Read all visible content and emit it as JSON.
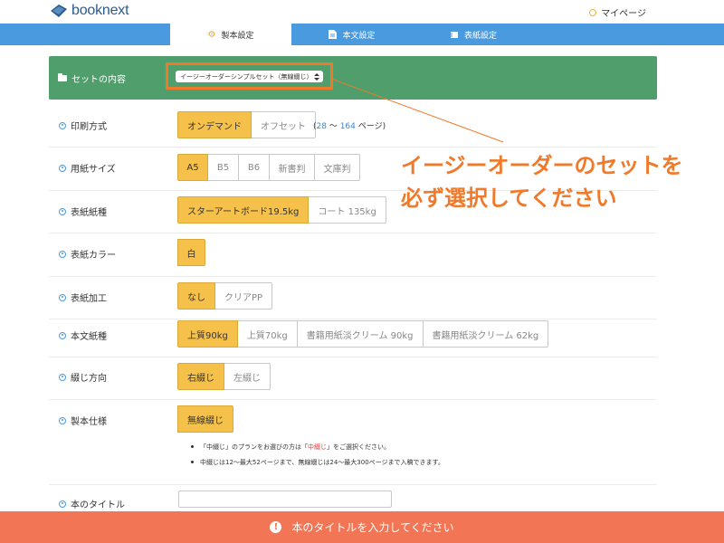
{
  "header": {
    "logo_text": "booknext",
    "mypage_label": "マイページ"
  },
  "tabs": [
    {
      "label": "製本設定",
      "icon": "gear-icon",
      "active": true
    },
    {
      "label": "本文設定",
      "icon": "document-icon",
      "active": false
    },
    {
      "label": "表紙設定",
      "icon": "book-icon",
      "active": false
    }
  ],
  "set": {
    "label": "セットの内容",
    "selected": "イージーオーダーシンプルセット（無線綴じ）"
  },
  "annotation": {
    "line1": "イージーオーダーのセットを",
    "line2": "必ず選択してください"
  },
  "rows": {
    "print": {
      "label": "印刷方式",
      "options": [
        "オンデマンド",
        "オフセット"
      ],
      "selected": 0,
      "pages_open": "(",
      "pages_min": "28",
      "pages_sep": " 〜 ",
      "pages_max": "164",
      "pages_unit": " ページ)"
    },
    "paper_size": {
      "label": "用紙サイズ",
      "options": [
        "A5",
        "B5",
        "B6",
        "新書判",
        "文庫判"
      ],
      "selected": 0
    },
    "cover_paper": {
      "label": "表紙紙種",
      "options": [
        "スターアートボード19.5kg",
        "コート 135kg"
      ],
      "selected": 0
    },
    "cover_color": {
      "label": "表紙カラー",
      "options": [
        "白"
      ],
      "selected": 0
    },
    "cover_finish": {
      "label": "表紙加工",
      "options": [
        "なし",
        "クリアPP"
      ],
      "selected": 0
    },
    "body_paper": {
      "label": "本文紙種",
      "options": [
        "上質90kg",
        "上質70kg",
        "書籍用紙淡クリーム 90kg",
        "書籍用紙淡クリーム 62kg"
      ],
      "selected": 0
    },
    "binding_dir": {
      "label": "綴じ方向",
      "options": [
        "右綴じ",
        "左綴じ"
      ],
      "selected": 0
    },
    "binding": {
      "label": "製本仕様",
      "options": [
        "無線綴じ"
      ],
      "selected": 0
    },
    "title": {
      "label": "本のタイトル",
      "value": ""
    }
  },
  "notes": {
    "note1_a": "「中綴じ」のプランをお選びの方は「",
    "note1_red": "中綴じ",
    "note1_b": "」をご選択ください。",
    "note2": "中綴じは12〜最大52ページまで、無線綴じは24〜最大300ページまで入稿できます。"
  },
  "alert": {
    "message": "本のタイトルを入力してください"
  },
  "colors": {
    "brand_blue": "#4a9ae0",
    "set_green": "#4f9e6c",
    "selected_yellow": "#f5c14a",
    "annotation_orange": "#f07a2a",
    "alert_red": "#f27555"
  }
}
